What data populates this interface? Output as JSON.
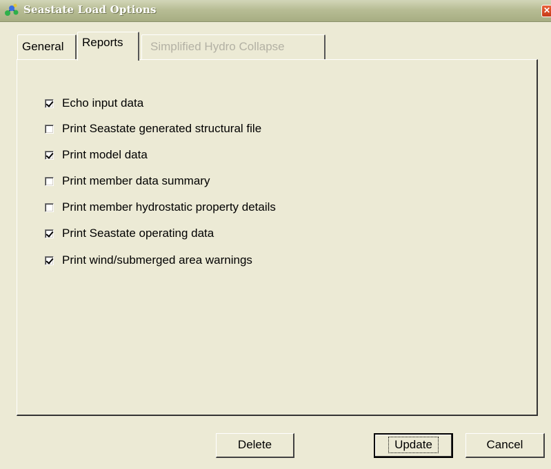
{
  "window": {
    "title": "Seastate Load Options",
    "close_glyph": "✕",
    "icon": "app-molecule-icon"
  },
  "tabs": [
    {
      "label": "General",
      "state": "inactive"
    },
    {
      "label": "Reports",
      "state": "active"
    },
    {
      "label": "Simplified Hydro Collapse",
      "state": "disabled"
    }
  ],
  "reports": {
    "options": [
      {
        "label": "Echo input data",
        "checked": true
      },
      {
        "label": "Print Seastate generated structural file",
        "checked": false
      },
      {
        "label": "Print model data",
        "checked": true
      },
      {
        "label": "Print member data summary",
        "checked": false
      },
      {
        "label": "Print member hydrostatic property details",
        "checked": false
      },
      {
        "label": "Print Seastate operating data",
        "checked": true
      },
      {
        "label": "Print wind/submerged area warnings",
        "checked": true
      }
    ]
  },
  "buttons": {
    "delete": "Delete",
    "update": "Update",
    "cancel": "Cancel"
  },
  "colors": {
    "dialog_bg": "#ecead5",
    "titlebar": "#b8bd95",
    "close": "#c63a18",
    "disabled_text": "#b3b1a4"
  }
}
